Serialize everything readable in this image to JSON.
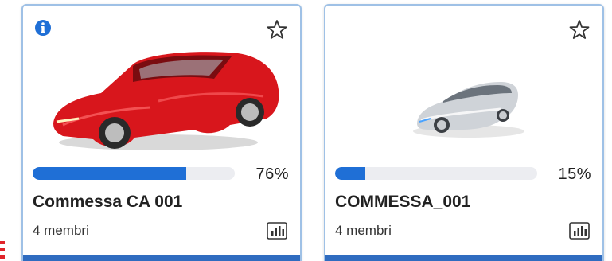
{
  "cards": [
    {
      "title": "Commessa CA 001",
      "members": "4 membri",
      "progress_percent": 76,
      "progress_label": "76%",
      "has_info_icon": true,
      "image": "red-sports-car"
    },
    {
      "title": "COMMESSA_001",
      "members": "4 membri",
      "progress_percent": 15,
      "progress_label": "15%",
      "has_info_icon": false,
      "image": "silver-concept-car"
    }
  ],
  "colors": {
    "accent": "#1f6fd6",
    "card_border": "#9fc1e6",
    "track": "#ecedf1",
    "bottom_strip": "#2f6cc0",
    "side_mark": "#e0242a"
  },
  "icons": {
    "info": "info-icon",
    "favorite": "star-icon",
    "stats": "bar-chart-icon"
  }
}
